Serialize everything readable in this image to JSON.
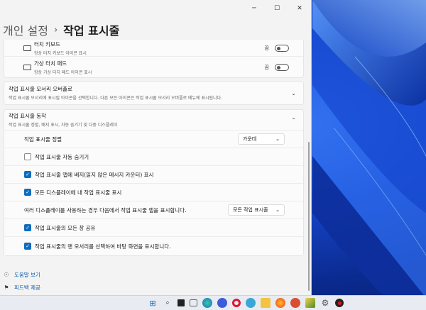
{
  "window": {
    "controls": {
      "minimize": "─",
      "maximize": "☐",
      "close": "✕"
    },
    "breadcrumb": {
      "parent": "개인 설정",
      "separator": "›",
      "current": "작업 표시줄"
    }
  },
  "pen_section": {
    "items": [
      {
        "title": "터치 키보드",
        "subtitle": "항상 터치 키보드 아이콘 표시",
        "toggle_label": "끔",
        "state": "off"
      },
      {
        "title": "가상 터치 패드",
        "subtitle": "항상 가상 터치 패드 아이콘 표시",
        "toggle_label": "끔",
        "state": "off"
      }
    ]
  },
  "overflow_section": {
    "title": "작업 표시줄 모서리 오버플로",
    "subtitle": "작업 표시줄 모서리에 표시될 아이콘을 선택합니다. 다른 모든 아이콘은 작업 표시줄 모서리 오버플로 메뉴에 표시됩니다."
  },
  "behaviors_section": {
    "title": "작업 표시줄 동작",
    "subtitle": "작업 표시줄 정렬, 배지 표시, 자동 숨기기 및 다중 디스플레이",
    "alignment": {
      "label": "작업 표시줄 정렬",
      "value": "가운데"
    },
    "checkboxes": [
      {
        "label": "작업 표시줄 자동 숨기기",
        "checked": false
      },
      {
        "label": "작업 표시줄 앱에 배지(읽지 않은 메시지 카운터) 표시",
        "checked": true
      },
      {
        "label": "모든 디스플레이에 내 작업 표시줄 표시",
        "checked": true
      }
    ],
    "multi_display": {
      "label": "여러 디스플레이를 사용하는 경우 다음에서 작업 표시줄 앱을 표시합니다.",
      "value": "모든 작업 표시줄"
    },
    "checkboxes2": [
      {
        "label": "작업 표시줄의 모든 창 공유",
        "checked": true
      },
      {
        "label": "작업 표시줄의 맨 모서리를 선택하여 바탕 화면을 표시합니다.",
        "checked": true
      }
    ]
  },
  "footer": {
    "help": "도움말 보기",
    "feedback": "피드백 제공"
  },
  "taskbar": {
    "icons": [
      "start-icon",
      "search-icon",
      "task-view-icon",
      "chat-icon",
      "edge-icon",
      "opera-icon",
      "explorer-icon",
      "firefox-icon",
      "app-icon",
      "settings-icon",
      "record-icon"
    ]
  },
  "colors": {
    "accent": "#0f6cbd",
    "window_bg": "#f3f3f3",
    "card_bg": "#fbfbfb"
  }
}
